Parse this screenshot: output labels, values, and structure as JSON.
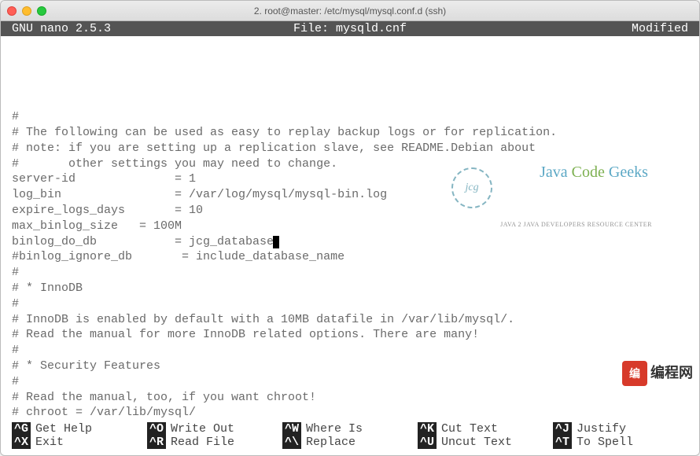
{
  "titlebar": {
    "title": "2. root@master: /etc/mysql/mysql.conf.d (ssh)"
  },
  "nano_header": {
    "left": "GNU nano 2.5.3",
    "center": "File: mysqld.cnf",
    "right": "Modified"
  },
  "editor_lines": [
    "#",
    "# The following can be used as easy to replay backup logs or for replication.",
    "# note: if you are setting up a replication slave, see README.Debian about",
    "#       other settings you may need to change.",
    "server-id              = 1",
    "log_bin                = /var/log/mysql/mysql-bin.log",
    "expire_logs_days       = 10",
    "max_binlog_size   = 100M",
    "binlog_do_db           = jcg_database",
    "#binlog_ignore_db       = include_database_name",
    "#",
    "# * InnoDB",
    "#",
    "# InnoDB is enabled by default with a 10MB datafile in /var/lib/mysql/.",
    "# Read the manual for more InnoDB related options. There are many!",
    "#",
    "# * Security Features",
    "#",
    "# Read the manual, too, if you want chroot!",
    "# chroot = /var/lib/mysql/",
    "#"
  ],
  "cursor_line": 8,
  "footer": {
    "row1": [
      {
        "key": "^G",
        "label": "Get Help"
      },
      {
        "key": "^O",
        "label": "Write Out"
      },
      {
        "key": "^W",
        "label": "Where Is"
      },
      {
        "key": "^K",
        "label": "Cut Text"
      },
      {
        "key": "^J",
        "label": "Justify"
      }
    ],
    "row2": [
      {
        "key": "^X",
        "label": "Exit"
      },
      {
        "key": "^R",
        "label": "Read File"
      },
      {
        "key": "^\\",
        "label": "Replace"
      },
      {
        "key": "^U",
        "label": "Uncut Text"
      },
      {
        "key": "^T",
        "label": "To Spell"
      }
    ]
  },
  "watermarks": {
    "jcg_circle": "jcg",
    "jcg_java": "Java ",
    "jcg_code": "Code ",
    "jcg_geeks": "Geeks",
    "jcg_sub": "Java 2 Java Developers Resource Center",
    "bc_logo": "编",
    "bc_text": "编程网"
  }
}
